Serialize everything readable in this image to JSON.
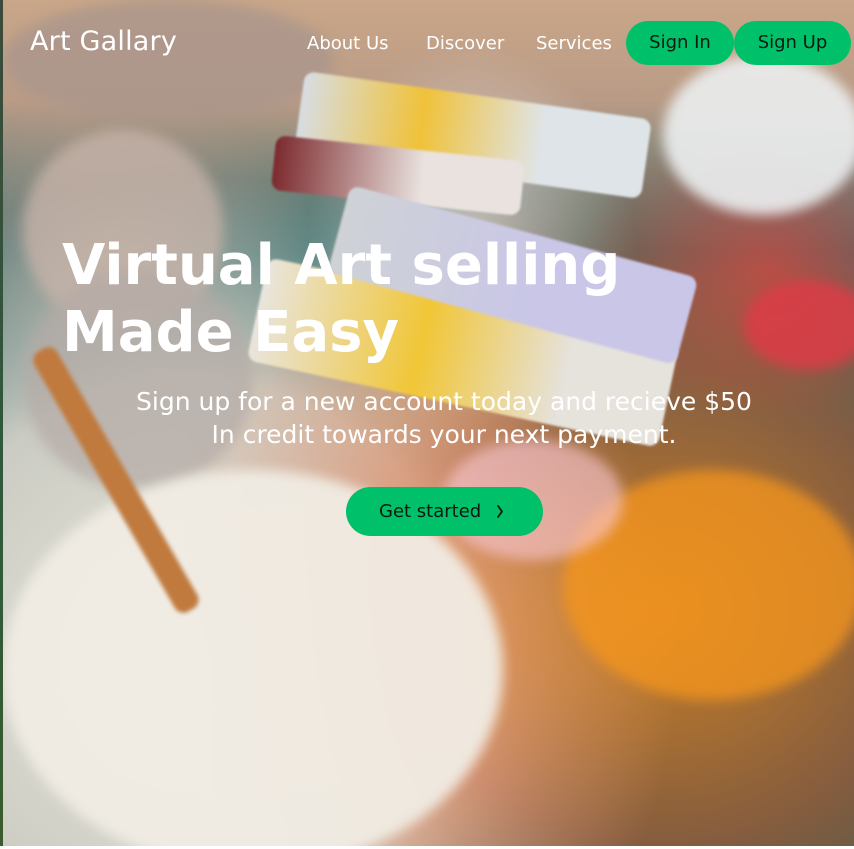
{
  "header": {
    "brand": "Art Gallary",
    "nav": [
      {
        "label": "About Us"
      },
      {
        "label": "Discover"
      },
      {
        "label": "Services"
      }
    ],
    "sign_in": "Sign In",
    "sign_up": "Sign Up"
  },
  "hero": {
    "headline": "Virtual Art selling Made Easy",
    "subline_1": "Sign up for a new account today and recieve $50",
    "subline_2": "In credit towards your next payment.",
    "cta_label": "Get started",
    "cta_icon": "chevron-right-icon"
  },
  "colors": {
    "accent": "#00c06a",
    "text_light": "#ffffff",
    "button_text": "#0d1a12"
  }
}
